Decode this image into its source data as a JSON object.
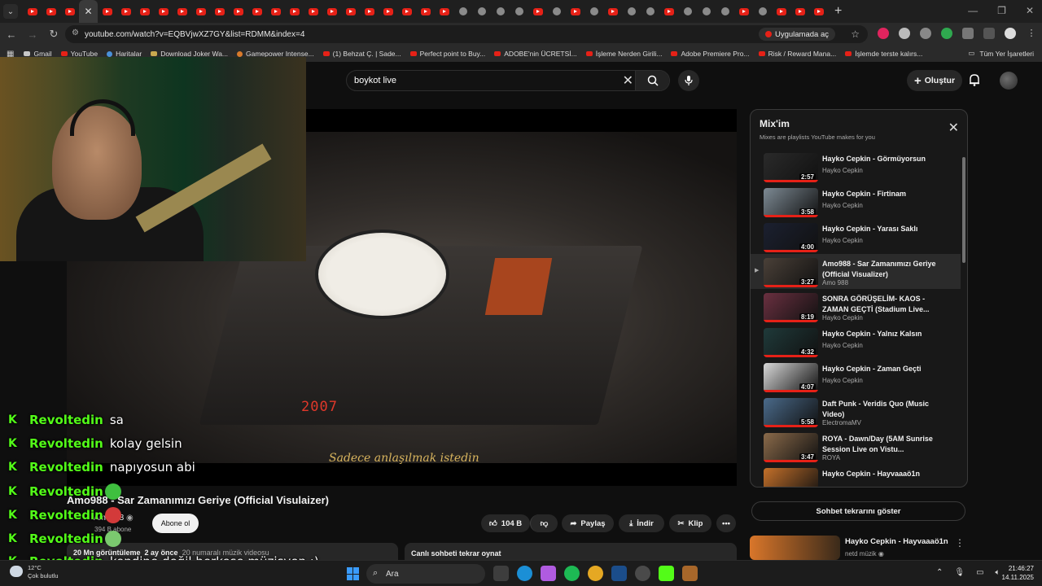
{
  "browser": {
    "url": "youtube.com/watch?v=EQBVjwXZ7GY&list=RDMM&index=4",
    "open_app_label": "Uygulamada aç",
    "bookmarks": [
      "Gmail",
      "YouTube",
      "Haritalar",
      "Download Joker Wa...",
      "Gamepower Intense...",
      "(1) Behzat Ç. | Sade...",
      "Perfect point to Buy...",
      "ADOBE'nin ÜCRETSİ...",
      "İşleme Nerden Girili...",
      "Adobe Premiere Pro...",
      "Risk / Reward Mana...",
      "İşlemde terste kalırs..."
    ],
    "all_bookmarks": "Tüm Yer İşaretleri"
  },
  "youtube": {
    "search_value": "boykot live",
    "create_label": "Oluştur",
    "video": {
      "led": "2007",
      "subtitle": "Sadece anlaşılmak istedin",
      "title": "Amo988 - Sar Zamanımızı Geriye (Official Visulaizer)",
      "channel": "Amo988",
      "subscribers": "394 B abone",
      "subscribe_label": "Abone ol",
      "likes": "104 B",
      "share": "Paylaş",
      "download": "İndir",
      "clip": "Klip",
      "views": "20 Mn görüntüleme",
      "age": "2 ay önce",
      "tag": "20 numaralı müzik videosu",
      "replay_chat_label": "Canlı sohbeti tekrar oynat"
    },
    "mix": {
      "title": "Mix'im",
      "subtitle": "Mixes are playlists YouTube makes for you",
      "items": [
        {
          "title": "Hayko Cepkin - Görmüyorsun",
          "channel": "Hayko Cepkin",
          "duration": "2:57",
          "thumb": "#2a2a2a"
        },
        {
          "title": "Hayko Cepkin - Firtinam",
          "channel": "Hayko Cepkin",
          "duration": "3:58",
          "thumb": "#7d8a94"
        },
        {
          "title": "Hayko Cepkin - Yarası Saklı",
          "channel": "Hayko Cepkin",
          "duration": "4:00",
          "thumb": "#1b2030"
        },
        {
          "title": "Amo988 - Sar Zamanımızı Geriye (Official Visualizer)",
          "channel": "Amo 988",
          "duration": "3:27",
          "thumb": "#4a4038"
        },
        {
          "title": "SONRA GÖRÜŞELİM- KAOS - ZAMAN GEÇTİ (Stadium Live...",
          "channel": "Hayko Cepkin",
          "duration": "8:19",
          "thumb": "#6a3040"
        },
        {
          "title": "Hayko Cepkin - Yalnız Kalsın",
          "channel": "Hayko Cepkin",
          "duration": "4:32",
          "thumb": "#1f3a3a"
        },
        {
          "title": "Hayko Cepkin - Zaman Geçti",
          "channel": "Hayko Cepkin",
          "duration": "4:07",
          "thumb": "#d8d8d8"
        },
        {
          "title": "Daft Punk - Veridis Quo (Music Video)",
          "channel": "ElectromaMV",
          "duration": "5:58",
          "thumb": "#4a6a8a"
        },
        {
          "title": "ROYA - Dawn/Day (5AM Sunrise Session Live on Vistu...",
          "channel": "ROYA",
          "duration": "3:47",
          "thumb": "#8a6a4a"
        },
        {
          "title": "Hayko Cepkin - Hayvaaaö1n",
          "channel": "",
          "duration": "",
          "thumb": "#c4702a"
        }
      ]
    },
    "show_chat_replay": "Sohbet tekrarını göster",
    "rec": {
      "title": "Hayko Cepkin - Hayvaaaö1n",
      "channel": "netd müzik"
    }
  },
  "chat": [
    {
      "user": "Revoltedin",
      "text": "sa"
    },
    {
      "user": "Revoltedin",
      "text": "kolay gelsin"
    },
    {
      "user": "Revoltedin",
      "text": "napıyosun abi"
    },
    {
      "user": "Revoltedin",
      "text": ""
    },
    {
      "user": "Revoltedin",
      "text": ""
    },
    {
      "user": "Revoltedin",
      "text": ""
    },
    {
      "user": "Revoltedin",
      "text": "kendine değil herkese müzisyen :)"
    }
  ],
  "taskbar": {
    "temp": "12°C",
    "weather": "Çok bulutlu",
    "search_label": "Ara",
    "time": "21:46:27",
    "date": "14.11.2025"
  }
}
